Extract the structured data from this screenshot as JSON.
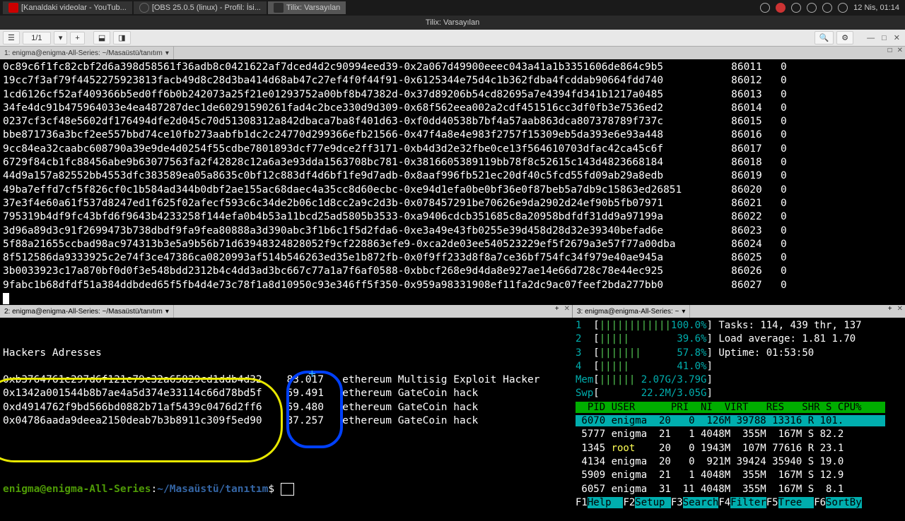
{
  "system": {
    "tabs": [
      {
        "icon": "yt",
        "label": "[Kanaldaki videolar - YouTub..."
      },
      {
        "icon": "obs",
        "label": "[OBS 25.0.5 (linux) - Profil: İsi..."
      },
      {
        "icon": "tilix",
        "label": "Tilix: Varsayılan"
      }
    ],
    "datetime": "12 Nis, 01:14"
  },
  "window_title": "Tilix: Varsayılan",
  "toolbar": {
    "page": "1/1",
    "search_icon": "🔍",
    "gear_icon": "⚙",
    "min": "—",
    "max": "□",
    "close": "✕"
  },
  "pane1_tab": "1: enigma@enigma-All-Series: ~/Masaüstü/tanıtım",
  "pane2_tab": "2: enigma@enigma-All-Series: ~/Masaüstü/tanıtım",
  "pane3_tab": "3: enigma@enigma-All-Series: ~",
  "pane1_lines": [
    {
      "h": "0c89c6f1fc82cbf2d6a398d58561f36adb8c0421622af7dced4d2c90994eed39-0x2a067d49900eeec043a41a1b3351606de864c9b5",
      "n": "86011",
      "z": "0"
    },
    {
      "h": "19cc7f3af79f4452275923813facb49d8c28d3ba414d68ab47c27ef4f0f44f91-0x6125344e75d4c1b362fdba4fcddab90664fdd740",
      "n": "86012",
      "z": "0"
    },
    {
      "h": "1cd6126cf52af409366b5ed0ff6b0b242073a25f21e01293752a00bf8b47382d-0x37d89206b54cd82695a7e4394fd341b1217a0485",
      "n": "86013",
      "z": "0"
    },
    {
      "h": "34fe4dc91b475964033e4ea487287dec1de60291590261fad4c2bce330d9d309-0x68f562eea002a2cdf451516cc3df0fb3e7536ed2",
      "n": "86014",
      "z": "0"
    },
    {
      "h": "0237cf3cf48e5602df176494dfe2d045c70d51308312a842dbaca7ba8f401d63-0xf0dd40538b7bf4a57aab863dca807378789f737c",
      "n": "86015",
      "z": "0"
    },
    {
      "h": "bbe871736a3bcf2ee557bbd74ce10fb273aabfb1dc2c24770d299366efb21566-0x47f4a8e4e983f2757f15309eb5da393e6e93a448",
      "n": "86016",
      "z": "0"
    },
    {
      "h": "9cc84ea32caabc608790a39e9de4d0254f55cdbe7801893dcf77e9dce2ff3171-0xb4d3d2e32fbe0ce13f564610703dfac42ca45c6f",
      "n": "86017",
      "z": "0"
    },
    {
      "h": "6729f84cb1fc88456abe9b63077563fa2f42828c12a6a3e93dda1563708bc781-0x3816605389119bb78f8c52615c143d4823668184",
      "n": "86018",
      "z": "0"
    },
    {
      "h": "44d9a157a82552bb4553dfc383589ea05a8635c0bf12c883df4d6bf1fe9d7adb-0x8aaf996fb521ec20df40c5fcd55fd09ab29a8edb",
      "n": "86019",
      "z": "0"
    },
    {
      "h": "49ba7effd7cf5f826cf0c1b584ad344b0dbf2ae155ac68daec4a35cc8d60ecbc-0xe94d1efa0be0bf36e0f87beb5a7db9c15863ed26851",
      "n": "86020",
      "z": "0"
    },
    {
      "h": "37e3f4e60a61f537d8247ed1f625f02afecf593c6c34de2b06c1d8cc2a9c2d3b-0x078457291be70626e9da2902d24ef90b5fb07971",
      "n": "86021",
      "z": "0"
    },
    {
      "h": "795319b4df9fc43bfd6f9643b4233258f144efa0b4b53a11bcd25ad5805b3533-0xa9406cdcb351685c8a20958bdfdf31dd9a97199a",
      "n": "86022",
      "z": "0"
    },
    {
      "h": "3d96a89d3c91f2699473b738dbdf9fa9fea80888a3d390abc3f1b6c1f5d2fda6-0xe3a49e43fb0255e39d458d28d32e39340befad6e",
      "n": "86023",
      "z": "0"
    },
    {
      "h": "5f88a21655ccbad98ac974313b3e5a9b56b71d63948324828052f9cf228863efe9-0xca2de03ee540523229ef5f2679a3e57f77a00dba",
      "n": "86024",
      "z": "0"
    },
    {
      "h": "8f512586da9333925c2e74f3ce47386ca0820993af514b546263ed35e1b872fb-0x0f9ff233d8f8a7ce36bf754fc34f979e40ae945a",
      "n": "86025",
      "z": "0"
    },
    {
      "h": "3b0033923c17a870bf0d0f3e548bdd2312b4c4dd3ad3bc667c77a1a7f6af0588-0xbbcf268e9d4da8e927ae14e66d728c78e44ec925",
      "n": "86026",
      "z": "0"
    },
    {
      "h": "9fabc1b68dfdf51a384ddbded65f5fb4d4e73c78f1a8d10950c93e346ff5f350-0x959a98331908ef11fa2dc9ac07feef2bda277bb0",
      "n": "86027",
      "z": "0"
    }
  ],
  "pane2": {
    "title": "Hackers Adresses",
    "rows": [
      {
        "addr": "0xb3764761e297d6f121e79c32a65829cd1ddb4d32",
        "val": "83.017",
        "desc": "ethereum Multisig Exploit Hacker"
      },
      {
        "addr": "0x1342a001544b8b7ae4a5d374e33114c66d78bd5f",
        "val": "59.491",
        "desc": "ethereum GateCoin hack"
      },
      {
        "addr": "0xd4914762f9bd566bd0882b71af5439c0476d2ff6",
        "val": "59.480",
        "desc": "ethereum GateCoin hack"
      },
      {
        "addr": "0x04786aada9deea2150deab7b3b8911c309f5ed90",
        "val": "37.257",
        "desc": "ethereum GateCoin hack"
      }
    ],
    "prompt_user": "enigma@enigma-All-Series",
    "prompt_path": "~/Masaüstü/tanıtım",
    "prompt_sym": "$"
  },
  "htop": {
    "cpus": [
      {
        "n": "1",
        "pct": "100.0%"
      },
      {
        "n": "2",
        "pct": "39.6%"
      },
      {
        "n": "3",
        "pct": "57.8%"
      },
      {
        "n": "4",
        "pct": "41.0%"
      }
    ],
    "mem": "2.07G/3.79G",
    "swp": "22.2M/3.05G",
    "tasks": "Tasks: 114, 439 thr, 137",
    "load": "Load average: 1.81 1.70",
    "uptime": "Uptime: 01:53:50",
    "hdr": "  PID USER      PRI  NI  VIRT   RES   SHR S CPU%",
    "rows": [
      {
        "pid": "6070",
        "user": "enigma",
        "pri": "20",
        "ni": "0",
        "virt": "126M",
        "res": "39788",
        "shr": "13316",
        "s": "R",
        "cpu": "101."
      },
      {
        "pid": "5777",
        "user": "enigma",
        "pri": "21",
        "ni": "1",
        "virt": "4048M",
        "res": "355M",
        "shr": "167M",
        "s": "S",
        "cpu": "82.2"
      },
      {
        "pid": "1345",
        "user": "root",
        "pri": "20",
        "ni": "0",
        "virt": "1943M",
        "res": "107M",
        "shr": "77616",
        "s": "R",
        "cpu": "23.1"
      },
      {
        "pid": "4134",
        "user": "enigma",
        "pri": "20",
        "ni": "0",
        "virt": "921M",
        "res": "39424",
        "shr": "35940",
        "s": "S",
        "cpu": "19.0"
      },
      {
        "pid": "5909",
        "user": "enigma",
        "pri": "21",
        "ni": "1",
        "virt": "4048M",
        "res": "355M",
        "shr": "167M",
        "s": "S",
        "cpu": "12.9"
      },
      {
        "pid": "6057",
        "user": "enigma",
        "pri": "31",
        "ni": "11",
        "virt": "4048M",
        "res": "355M",
        "shr": "167M",
        "s": "S",
        "cpu": "8.1"
      }
    ],
    "fkeys": [
      [
        "F1",
        "Help"
      ],
      [
        "F2",
        "Setup"
      ],
      [
        "F3",
        "Search"
      ],
      [
        "F4",
        "Filter"
      ],
      [
        "F5",
        "Tree"
      ],
      [
        "F6",
        "SortBy"
      ]
    ]
  }
}
